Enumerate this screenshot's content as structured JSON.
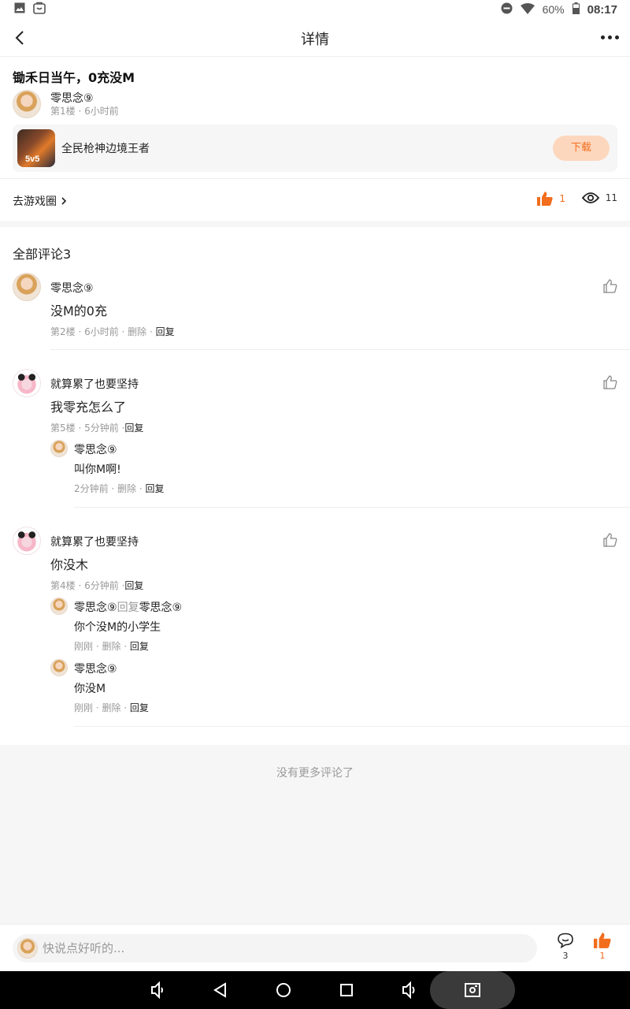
{
  "status_bar": {
    "battery": "60%",
    "time": "08:17"
  },
  "header": {
    "title": "详情"
  },
  "post": {
    "title": "锄禾日当午，0充没M",
    "author": "零思念⑨",
    "meta": "第1楼 · 6小时前",
    "game": {
      "name": "全民枪神边境王者",
      "download_label": "下载",
      "icon_tag": "5v5"
    },
    "go_circle": "去游戏圈",
    "likes": "1",
    "views": "11"
  },
  "comments_title": "全部评论3",
  "comments": [
    {
      "name": "零思念⑨",
      "text": "没M的0充",
      "meta_prefix": "第2楼 · 6小时前 · 删除 · ",
      "reply_label": "回复"
    },
    {
      "name": "就算累了也要坚持",
      "text": "我零充怎么了",
      "meta_prefix": "第5楼 · 5分钟前 ·",
      "reply_label": "回复",
      "replies": [
        {
          "name": "零思念⑨",
          "text": "叫你M啊!",
          "meta_prefix": "2分钟前 · 删除 · ",
          "reply_label": "回复"
        }
      ]
    },
    {
      "name": "就算累了也要坚持",
      "text": "你没木",
      "meta_prefix": "第4楼 · 6分钟前 ·",
      "reply_label": "回复",
      "replies": [
        {
          "name": "零思念⑨",
          "reply_word": "回复",
          "reply_to": "零思念⑨",
          "text": "你个没M的小学生",
          "meta_prefix": "刚刚 · 删除 · ",
          "reply_label": "回复"
        },
        {
          "name": "零思念⑨",
          "text": "你没M",
          "meta_prefix": "刚刚 · 删除 · ",
          "reply_label": "回复"
        }
      ]
    }
  ],
  "no_more": "没有更多评论了",
  "bottom_bar": {
    "placeholder": "快说点好听的...",
    "comment_count": "3",
    "like_count": "1"
  },
  "colors": {
    "accent": "#f26d1c",
    "download_bg": "#fdd7bd"
  }
}
